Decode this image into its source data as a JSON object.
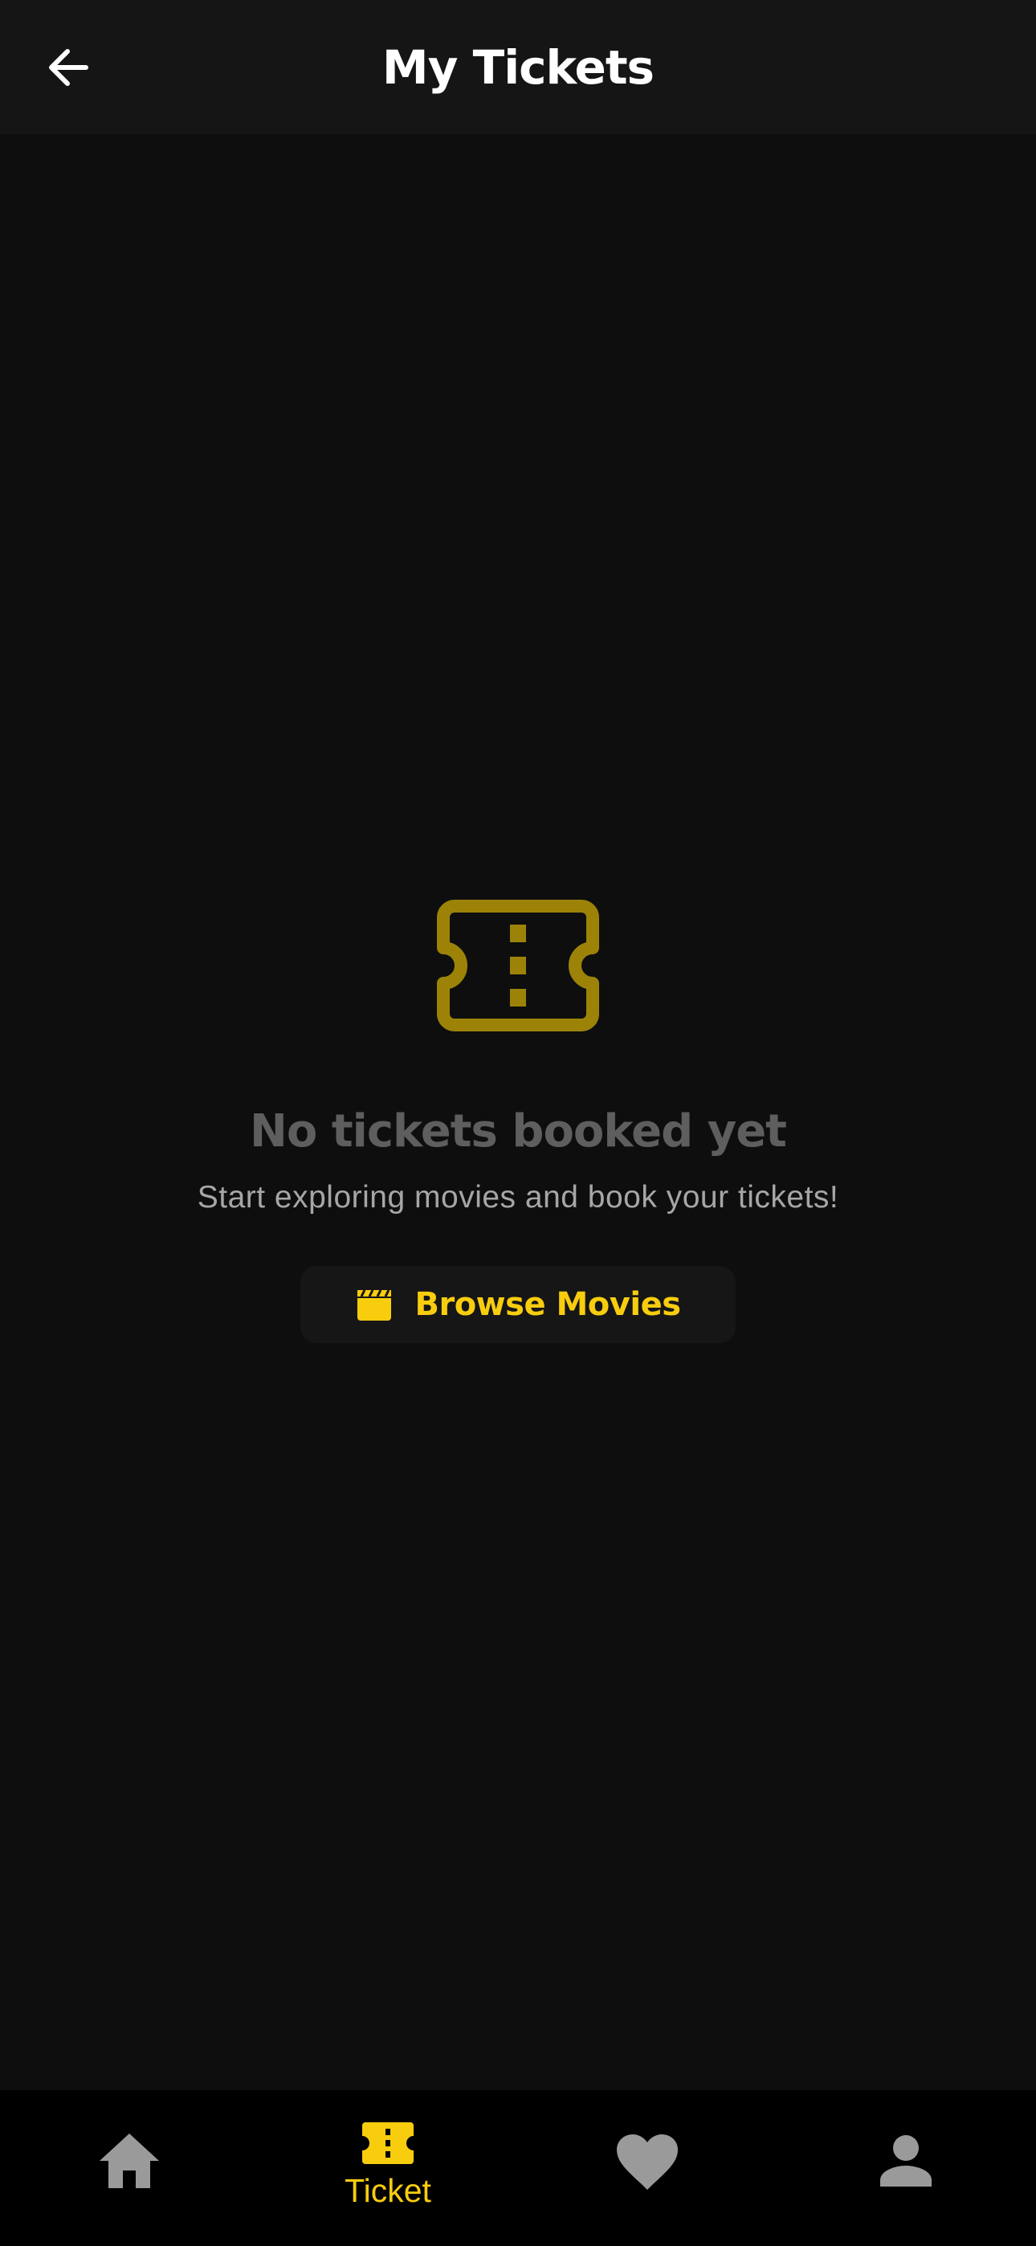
{
  "header": {
    "title": "My Tickets",
    "back_icon": "arrow-left-icon"
  },
  "empty_state": {
    "icon": "ticket-icon",
    "title": "No tickets booked yet",
    "subtitle": "Start exploring movies and book your tickets!",
    "button_label": "Browse Movies",
    "button_icon": "clapperboard-icon"
  },
  "bottom_nav": {
    "items": [
      {
        "icon": "home-icon",
        "label": "",
        "active": false
      },
      {
        "icon": "ticket-icon",
        "label": "Ticket",
        "active": true
      },
      {
        "icon": "heart-icon",
        "label": "",
        "active": false
      },
      {
        "icon": "person-icon",
        "label": "",
        "active": false
      }
    ]
  },
  "colors": {
    "background": "#0e0e0e",
    "header": "#151515",
    "accent": "#f8cd0e",
    "accent_dim": "#9c8307",
    "inactive_icon": "#9a9a9a",
    "empty_title": "#5e5e5e",
    "subtitle": "#a6a6a6",
    "nav_background": "#000000"
  }
}
